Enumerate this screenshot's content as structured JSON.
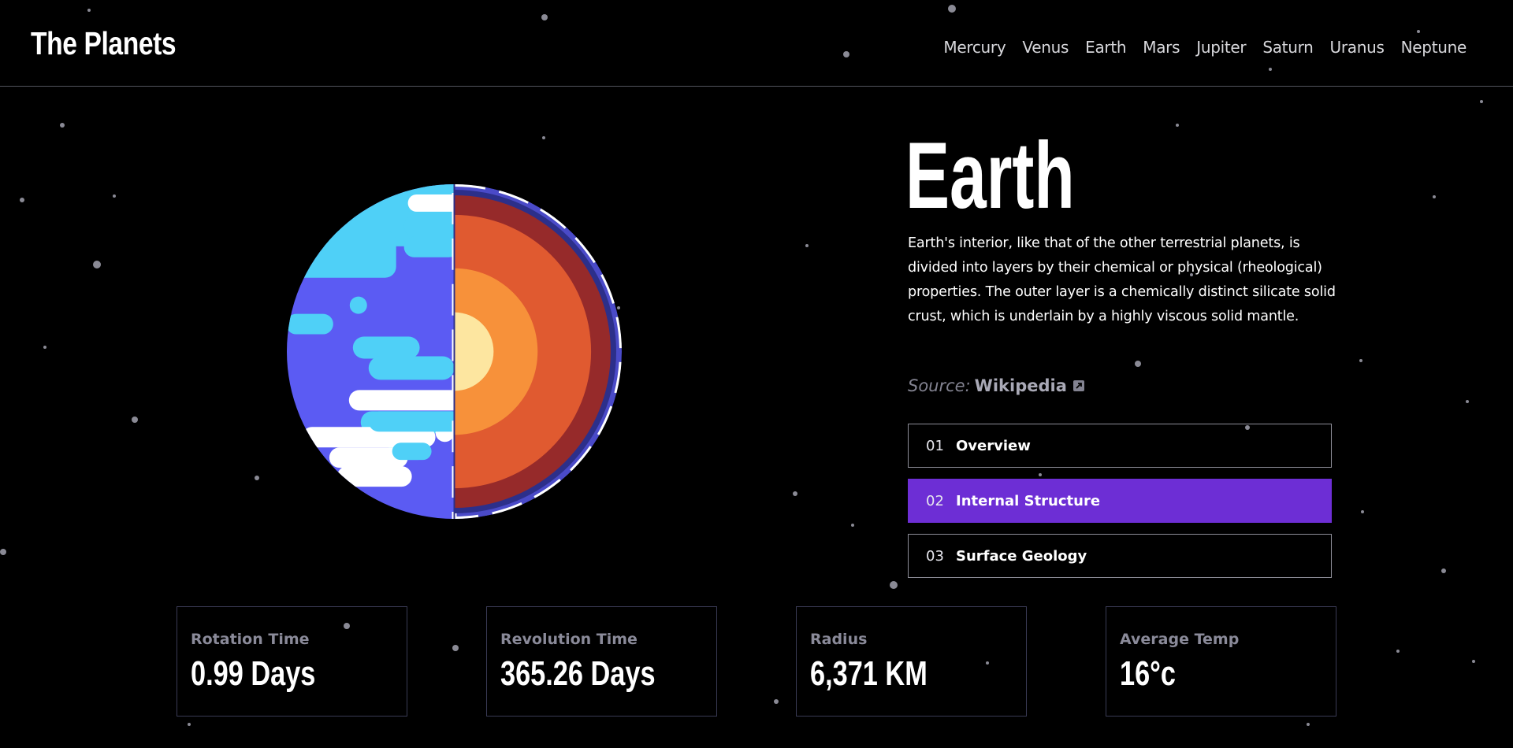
{
  "app": {
    "logo": "The Planets"
  },
  "nav": {
    "items": [
      "Mercury",
      "Venus",
      "Earth",
      "Mars",
      "Jupiter",
      "Saturn",
      "Uranus",
      "Neptune"
    ]
  },
  "planet": {
    "name": "Earth",
    "description": "Earth's interior, like that of the other terrestrial planets, is divided into layers by their chemical or physical (rheological) properties. The outer layer is a chemically distinct silicate solid crust, which is underlain by a highly viscous solid mantle.",
    "image_icon": "earth-internal-structure-illustration"
  },
  "source": {
    "label": "Source:",
    "link_text": "Wikipedia",
    "icon": "external-link-icon"
  },
  "tabs": [
    {
      "number": "01",
      "label": "Overview",
      "active": false
    },
    {
      "number": "02",
      "label": "Internal Structure",
      "active": true
    },
    {
      "number": "03",
      "label": "Surface Geology",
      "active": false
    }
  ],
  "stats": [
    {
      "label": "Rotation Time",
      "value": "0.99 Days"
    },
    {
      "label": "Revolution Time",
      "value": "365.26 Days"
    },
    {
      "label": "Radius",
      "value": "6,371 KM"
    },
    {
      "label": "Average Temp",
      "value": "16°c"
    }
  ],
  "colors": {
    "accent": "#6D2ED5",
    "background": "#000000",
    "divider": "#52545E",
    "stat_border": "#3A3B55"
  }
}
